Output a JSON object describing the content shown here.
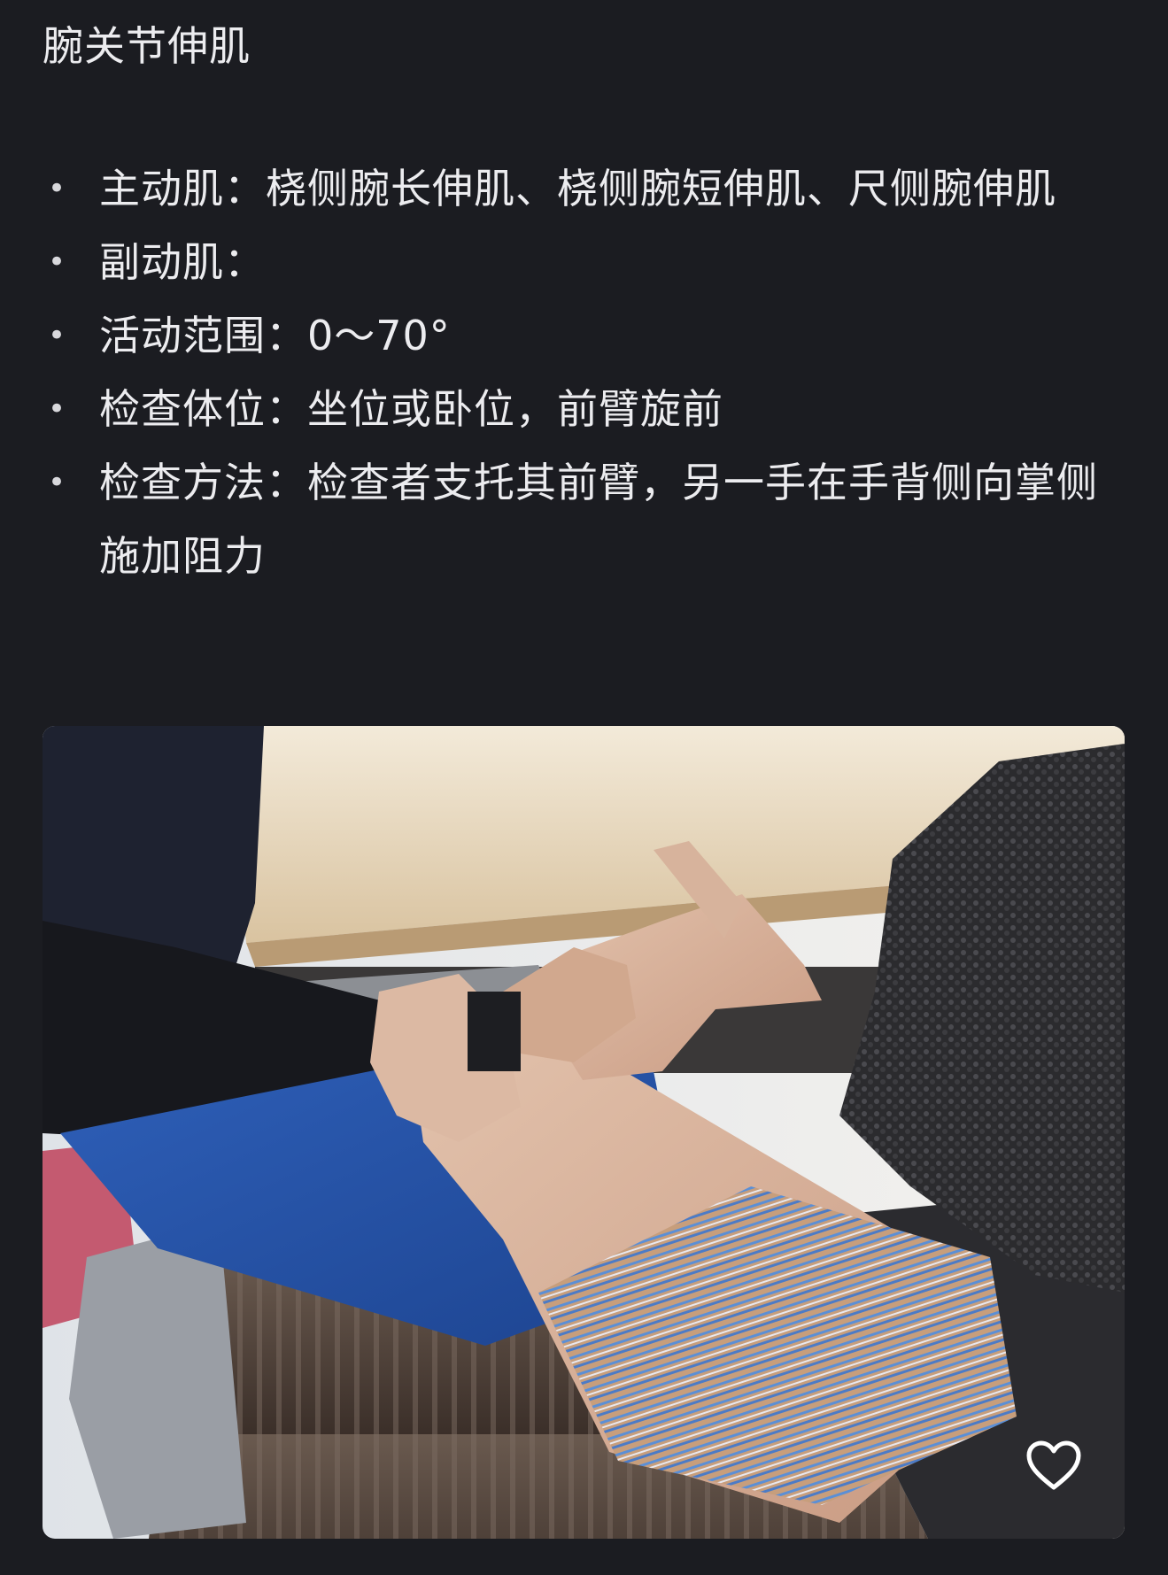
{
  "section": {
    "title": "腕关节伸肌"
  },
  "items": [
    {
      "text": "主动肌：桡侧腕长伸肌、桡侧腕短伸肌、尺侧腕伸肌"
    },
    {
      "text": "副动肌："
    },
    {
      "text": "活动范围：0～70°"
    },
    {
      "text": "检查体位：坐位或卧位，前臂旋前"
    },
    {
      "text": "检查方法：检查者支托其前臂，另一手在手背侧向掌侧施加阻力"
    }
  ],
  "photo": {
    "icon": "heart-icon"
  },
  "colors": {
    "background": "#1b1c21",
    "text": "#ececef"
  }
}
